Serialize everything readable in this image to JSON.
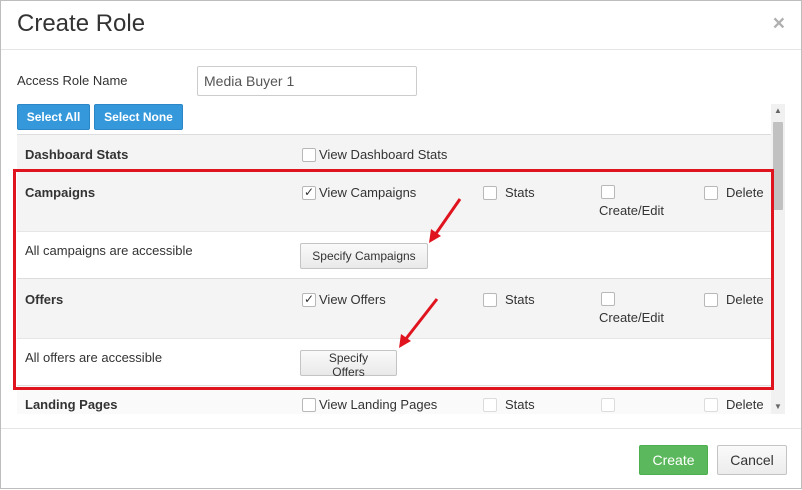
{
  "modal": {
    "title": "Create Role",
    "close_glyph": "×"
  },
  "form": {
    "access_role_label": "Access Role Name",
    "access_role_value": "Media Buyer 1"
  },
  "toolbar": {
    "select_all": "Select All",
    "select_none": "Select None"
  },
  "sections": {
    "dashboard": {
      "title": "Dashboard Stats",
      "view_label": "View Dashboard Stats",
      "view_checked": false
    },
    "campaigns": {
      "title": "Campaigns",
      "view_label": "View Campaigns",
      "view_checked": true,
      "stats_label": "Stats",
      "create_edit_label": "Create/Edit",
      "delete_label": "Delete",
      "access_text": "All campaigns are accessible",
      "specify_button": "Specify Campaigns"
    },
    "offers": {
      "title": "Offers",
      "view_label": "View Offers",
      "view_checked": true,
      "stats_label": "Stats",
      "create_edit_label": "Create/Edit",
      "delete_label": "Delete",
      "access_text": "All offers are accessible",
      "specify_button": "Specify Offers"
    },
    "landing_pages": {
      "title": "Landing Pages",
      "view_label": "View Landing Pages",
      "view_checked": false,
      "stats_label": "Stats",
      "delete_label": "Delete"
    }
  },
  "footer": {
    "create": "Create",
    "cancel": "Cancel"
  },
  "colors": {
    "primary_blue": "#3498db",
    "success_green": "#5cb85c",
    "highlight_red": "#e0141e"
  }
}
